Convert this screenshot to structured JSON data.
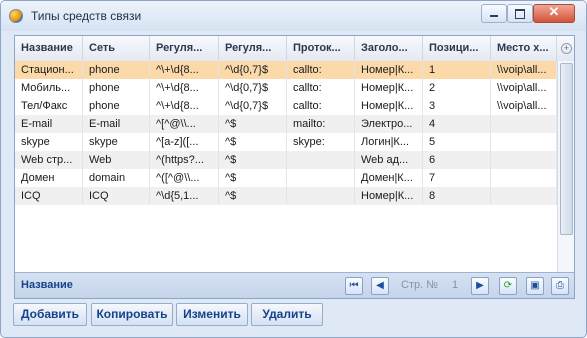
{
  "window": {
    "title": "Типы средств связи",
    "icon": "globe-icon",
    "controls": {
      "minimize": "minimize-icon",
      "maximize": "maximize-icon",
      "close": "close-icon"
    }
  },
  "grid": {
    "columns": [
      "Название",
      "Сеть",
      "Регуля...",
      "Регуля...",
      "Проток...",
      "Заголо...",
      "Позици...",
      "Место х..."
    ],
    "rows": [
      [
        "Стацион...",
        "phone",
        "^\\+\\d{8...",
        "^\\d{0,7}$",
        "callto:",
        "Номер|К...",
        "1",
        "\\\\voip\\all..."
      ],
      [
        "Мобиль...",
        "phone",
        "^\\+\\d{8...",
        "^\\d{0,7}$",
        "callto:",
        "Номер|К...",
        "2",
        "\\\\voip\\all..."
      ],
      [
        "Тел/Факс",
        "phone",
        "^\\+\\d{8...",
        "^\\d{0,7}$",
        "callto:",
        "Номер|К...",
        "3",
        "\\\\voip\\all..."
      ],
      [
        "E-mail",
        "E-mail",
        "^[^@\\\\...",
        "^$",
        "mailto:",
        "Электро...",
        "4",
        ""
      ],
      [
        "skype",
        "skype",
        "^[a-z]([...",
        "^$",
        "skype:",
        "Логин|К...",
        "5",
        ""
      ],
      [
        "Web стр...",
        "Web",
        "^(https?...",
        "^$",
        "",
        "Web ад...",
        "6",
        ""
      ],
      [
        "Домен",
        "domain",
        "^([^@\\\\...",
        "^$",
        "",
        "Домен|К...",
        "7",
        ""
      ],
      [
        "ICQ",
        "ICQ",
        "^\\d{5,1...",
        "^$",
        "",
        "Номер|К...",
        "8",
        ""
      ]
    ],
    "selected_row": 0
  },
  "pager": {
    "label": "Название",
    "page_text": "Стр. №",
    "page_number": "1"
  },
  "toolbar": {
    "add_label": "Добавить",
    "copy_label": "Копировать",
    "edit_label": "Изменить",
    "delete_label": "Удалить"
  },
  "colors": {
    "selected_row": "#fbd9a9",
    "header_text": "#15428b",
    "close_button": "#d2533a"
  }
}
